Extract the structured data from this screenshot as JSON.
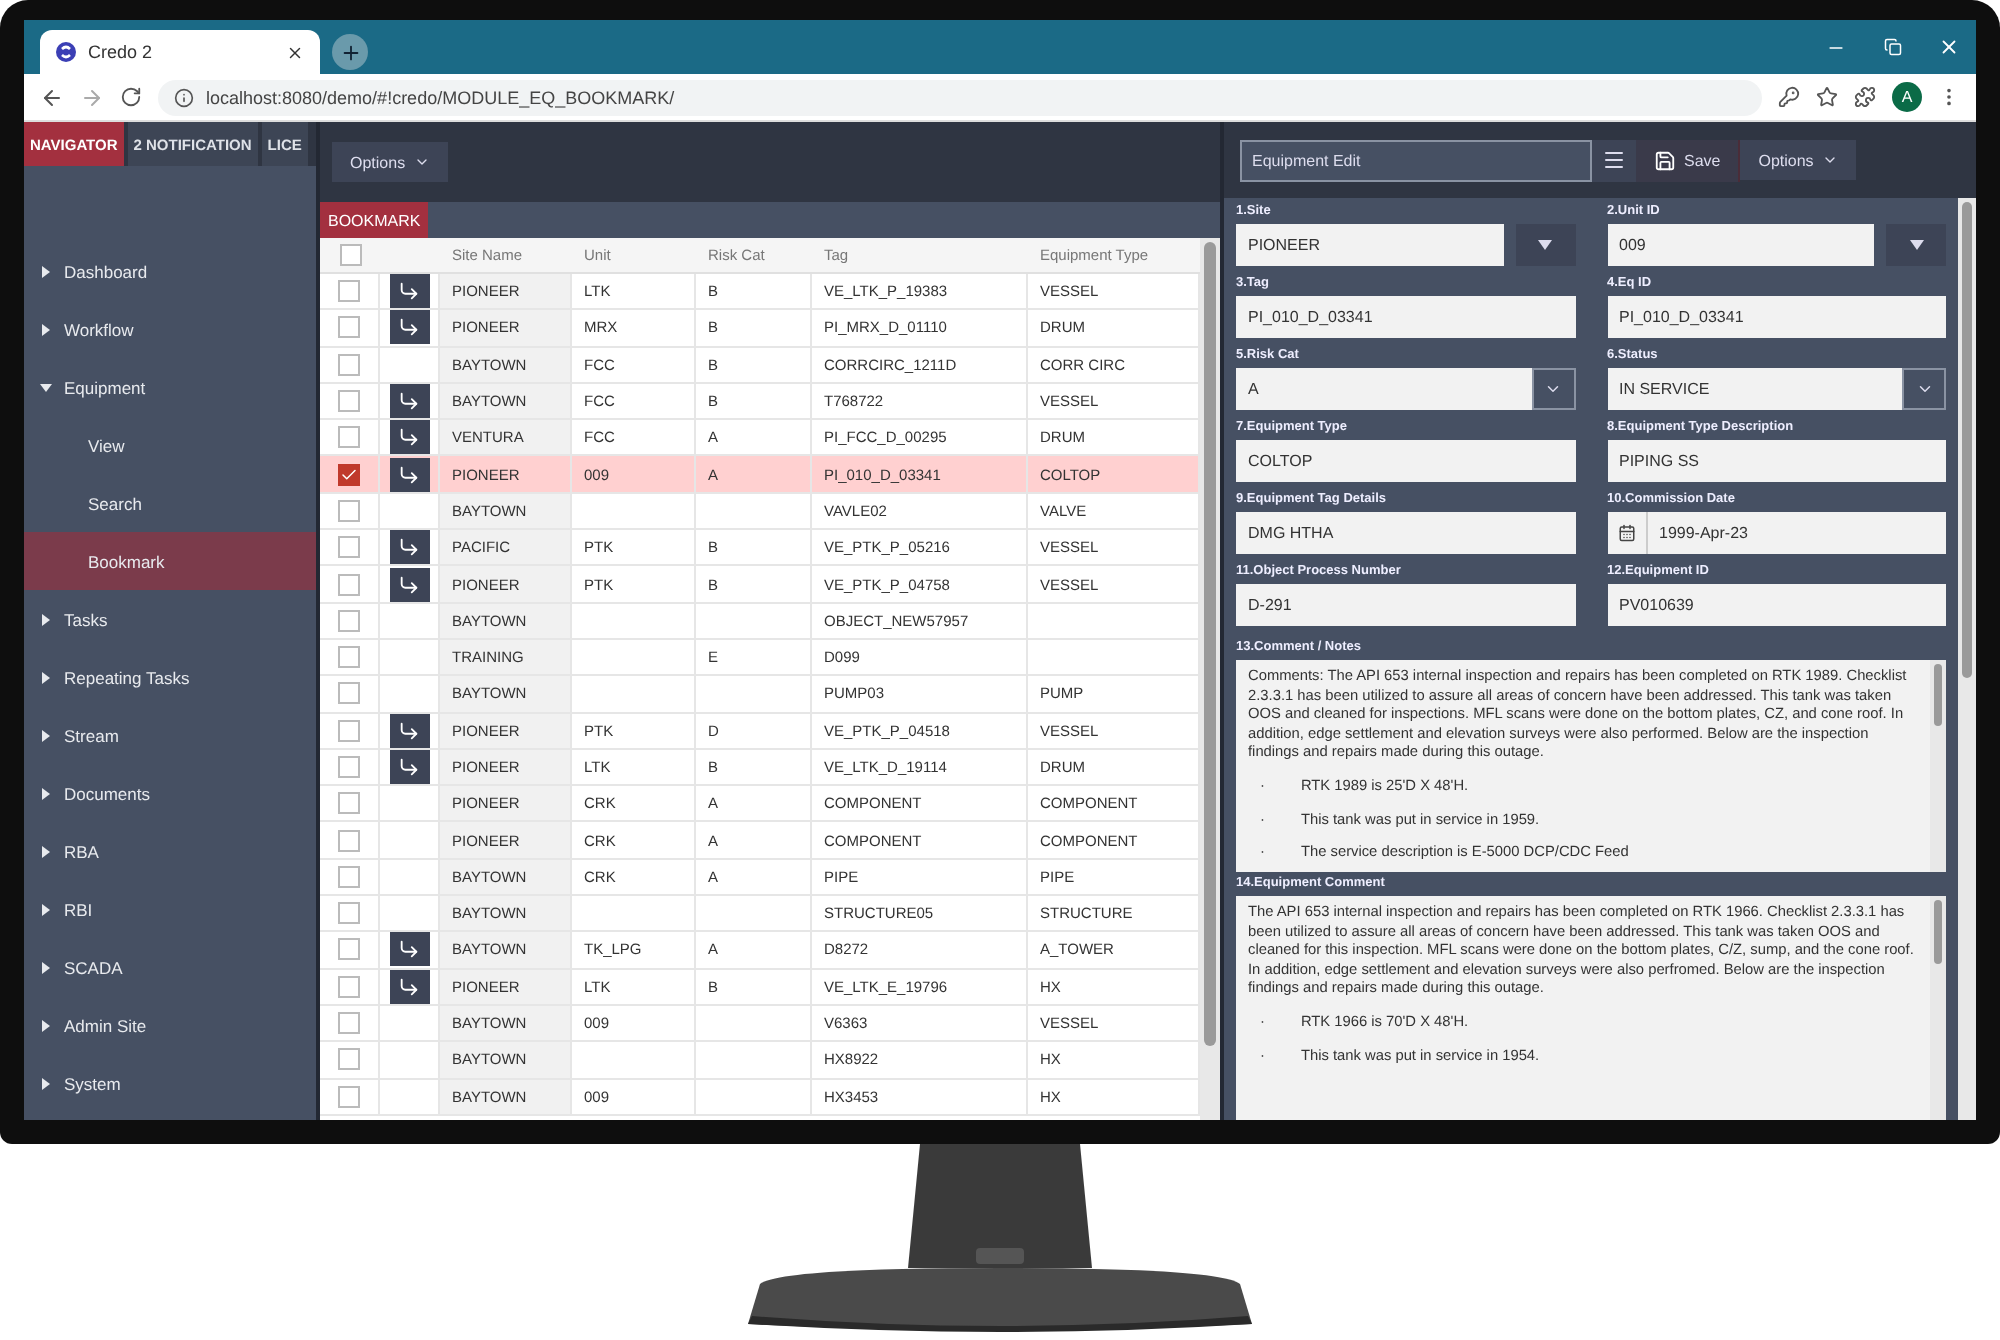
{
  "browser": {
    "tab_title": "Credo 2",
    "url": "localhost:8080/demo/#!credo/MODULE_EQ_BOOKMARK/",
    "avatar": "A"
  },
  "nav": {
    "tabs": [
      {
        "label": "NAVIGATOR",
        "selected": true
      },
      {
        "label": "2 NOTIFICATION",
        "selected": false
      },
      {
        "label": "LICE",
        "selected": false
      }
    ],
    "items": [
      {
        "label": "Dashboard",
        "expanded": false,
        "selected": false
      },
      {
        "label": "Workflow",
        "expanded": false,
        "selected": false
      },
      {
        "label": "Equipment",
        "expanded": true,
        "selected": false,
        "children": [
          {
            "label": "View",
            "selected": false
          },
          {
            "label": "Search",
            "selected": false
          },
          {
            "label": "Bookmark",
            "selected": true
          }
        ]
      },
      {
        "label": "Tasks",
        "expanded": false,
        "selected": false
      },
      {
        "label": "Repeating Tasks",
        "expanded": false,
        "selected": false
      },
      {
        "label": "Stream",
        "expanded": false,
        "selected": false
      },
      {
        "label": "Documents",
        "expanded": false,
        "selected": false
      },
      {
        "label": "RBA",
        "expanded": false,
        "selected": false
      },
      {
        "label": "RBI",
        "expanded": false,
        "selected": false
      },
      {
        "label": "SCADA",
        "expanded": false,
        "selected": false
      },
      {
        "label": "Admin Site",
        "expanded": false,
        "selected": false
      },
      {
        "label": "System",
        "expanded": false,
        "selected": false
      }
    ]
  },
  "list": {
    "options_button": "Options",
    "tab": "BOOKMARK",
    "all_checked": false,
    "columns": [
      "Site Name",
      "Unit",
      "Risk Cat",
      "Tag",
      "Equipment Type"
    ],
    "rows": [
      {
        "site": "PIONEER",
        "unit": "LTK",
        "risk": "B",
        "tag": "VE_LTK_P_19383",
        "type": "VESSEL",
        "linked": true,
        "selected": false
      },
      {
        "site": "PIONEER",
        "unit": "MRX",
        "risk": "B",
        "tag": "PI_MRX_D_01110",
        "type": "DRUM",
        "linked": true,
        "selected": false
      },
      {
        "site": "BAYTOWN",
        "unit": "FCC",
        "risk": "B",
        "tag": "CORRCIRC_1211D",
        "type": "CORR CIRC",
        "linked": false,
        "selected": false
      },
      {
        "site": "BAYTOWN",
        "unit": "FCC",
        "risk": "B",
        "tag": "T768722",
        "type": "VESSEL",
        "linked": true,
        "selected": false
      },
      {
        "site": "VENTURA",
        "unit": "FCC",
        "risk": "A",
        "tag": "PI_FCC_D_00295",
        "type": "DRUM",
        "linked": true,
        "selected": false
      },
      {
        "site": "PIONEER",
        "unit": "009",
        "risk": "A",
        "tag": "PI_010_D_03341",
        "type": "COLTOP",
        "linked": true,
        "selected": true
      },
      {
        "site": "BAYTOWN",
        "tag": "VAVLE02",
        "type": "VALVE",
        "linked": false,
        "selected": false
      },
      {
        "site": "PACIFIC",
        "unit": "PTK",
        "risk": "B",
        "tag": "VE_PTK_P_05216",
        "type": "VESSEL",
        "linked": true,
        "selected": false
      },
      {
        "site": "PIONEER",
        "unit": "PTK",
        "risk": "B",
        "tag": "VE_PTK_P_04758",
        "type": "VESSEL",
        "linked": true,
        "selected": false
      },
      {
        "site": "BAYTOWN",
        "tag": "OBJECT_NEW57957",
        "linked": false,
        "selected": false
      },
      {
        "site": "TRAINING",
        "risk": "E",
        "tag": "D099",
        "linked": false,
        "selected": false
      },
      {
        "site": "BAYTOWN",
        "tag": "PUMP03",
        "type": "PUMP",
        "linked": false,
        "selected": false
      },
      {
        "site": "PIONEER",
        "unit": "PTK",
        "risk": "D",
        "tag": "VE_PTK_P_04518",
        "type": "VESSEL",
        "linked": true,
        "selected": false
      },
      {
        "site": "PIONEER",
        "unit": "LTK",
        "risk": "B",
        "tag": "VE_LTK_D_19114",
        "type": "DRUM",
        "linked": true,
        "selected": false
      },
      {
        "site": "PIONEER",
        "unit": "CRK",
        "risk": "A",
        "tag": "COMPONENT",
        "type": "COMPONENT",
        "linked": false,
        "selected": false
      },
      {
        "site": "PIONEER",
        "unit": "CRK",
        "risk": "A",
        "tag": "COMPONENT",
        "type": "COMPONENT",
        "linked": false,
        "selected": false
      },
      {
        "site": "BAYTOWN",
        "unit": "CRK",
        "risk": "A",
        "tag": "PIPE",
        "type": "PIPE",
        "linked": false,
        "selected": false
      },
      {
        "site": "BAYTOWN",
        "tag": "STRUCTURE05",
        "type": "STRUCTURE",
        "linked": false,
        "selected": false
      },
      {
        "site": "BAYTOWN",
        "unit": "TK_LPG",
        "risk": "A",
        "tag": "D8272",
        "type": "A_TOWER",
        "linked": true,
        "selected": false
      },
      {
        "site": "PIONEER",
        "unit": "LTK",
        "risk": "B",
        "tag": "VE_LTK_E_19796",
        "type": "HX",
        "linked": true,
        "selected": false
      },
      {
        "site": "BAYTOWN",
        "unit": "009",
        "tag": "V6363",
        "type": "VESSEL",
        "linked": false,
        "selected": false
      },
      {
        "site": "BAYTOWN",
        "tag": "HX8922",
        "type": "HX",
        "linked": false,
        "selected": false
      },
      {
        "site": "BAYTOWN",
        "unit": "009",
        "tag": "HX3453",
        "type": "HX",
        "linked": false,
        "selected": false
      }
    ]
  },
  "editor": {
    "title_field": "Equipment Edit",
    "save": "Save",
    "options": "Options",
    "fields": [
      {
        "label": "1.Site",
        "value": "PIONEER",
        "kind": "dropdown"
      },
      {
        "label": "2.Unit ID",
        "value": "009",
        "kind": "dropdown"
      },
      {
        "label": "3.Tag",
        "value": "PI_010_D_03341",
        "kind": "text"
      },
      {
        "label": "4.Eq ID",
        "value": "PI_010_D_03341",
        "kind": "text"
      },
      {
        "label": "5.Risk Cat",
        "value": "A",
        "kind": "select"
      },
      {
        "label": "6.Status",
        "value": "IN SERVICE",
        "kind": "select"
      },
      {
        "label": "7.Equipment Type",
        "value": "COLTOP",
        "kind": "text"
      },
      {
        "label": "8.Equipment Type Description",
        "value": "PIPING SS",
        "kind": "text"
      },
      {
        "label": "9.Equipment Tag Details",
        "value": "DMG HTHA",
        "kind": "text"
      },
      {
        "label": "10.Commission Date",
        "value": "1999-Apr-23",
        "kind": "date"
      },
      {
        "label": "11.Object Process Number",
        "value": "D-291",
        "kind": "text"
      },
      {
        "label": "12.Equipment ID",
        "value": "PV010639",
        "kind": "text"
      }
    ],
    "notes": [
      {
        "label": "13.Comment / Notes",
        "paragraph": "Comments: The API 653 internal inspection and repairs has been completed on RTK 1989. Checklist 2.3.3.1 has been utilized to assure all areas of concern have been addressed. This tank was taken OOS and cleaned for inspections. MFL scans were done on the bottom plates, CZ, and cone roof. In addition, edge settlement and elevation surveys were also performed. Below are the inspection findings and repairs made during this outage.",
        "bullets": [
          {
            "marker": "·",
            "text": "RTK 1989 is 25'D X 48'H."
          },
          {
            "marker": "·",
            "text": "This tank was put in service in 1959."
          },
          {
            "marker": "·",
            "text": "The service description is E-5000 DCP/CDC Feed"
          }
        ]
      },
      {
        "label": "14.Equipment Comment",
        "paragraph": "The API 653 internal inspection and repairs has been completed on RTK 1966. Checklist 2.3.3.1 has been utilized to assure all areas of concern have been addressed. This tank was taken OOS and cleaned for this inspection. MFL scans were done on the bottom plates, C/Z, sump, and the cone roof. In addition, edge settlement and elevation surveys were also perfromed. Below are the inspection findings and repairs made during this outage.",
        "bullets": [
          {
            "marker": "·",
            "text": "RTK 1966 is 70'D X 48'H."
          },
          {
            "marker": "·",
            "text": "This tank was put in service in 1954."
          }
        ]
      }
    ]
  }
}
